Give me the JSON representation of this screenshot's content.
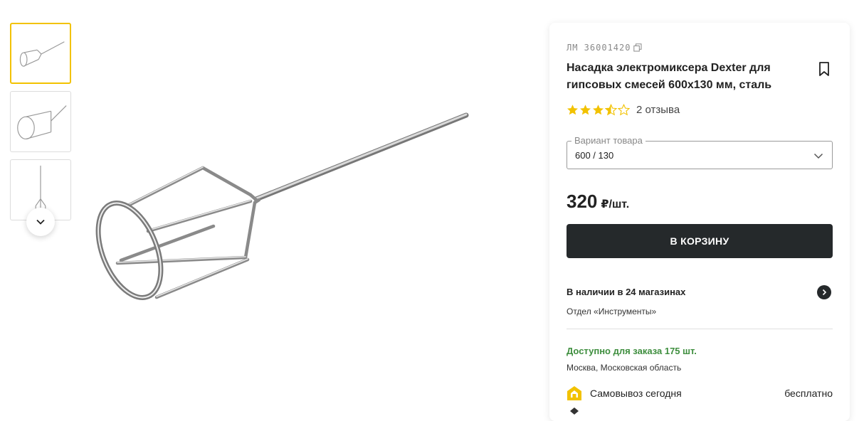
{
  "gallery": {
    "thumbnails": [
      {
        "name": "thumbnail-1",
        "active": true
      },
      {
        "name": "thumbnail-2",
        "active": false
      },
      {
        "name": "thumbnail-3",
        "active": false
      }
    ],
    "scroll_icon": "chevron-down-icon"
  },
  "product": {
    "sku": "ЛМ 36001420",
    "copy_icon": "copy-icon",
    "title": "Насадка электромиксера Dexter для гипсовых смесей 600x130 мм, сталь",
    "bookmark_icon": "bookmark-icon",
    "rating": 3.5,
    "reviews": "2 отзыва",
    "variant_label": "Вариант товара",
    "variant_value": "600 / 130",
    "price": "320",
    "price_unit": "₽/шт.",
    "cart_button": "В КОРЗИНУ",
    "stock_title": "В наличии в 24 магазинах",
    "stock_dept": "Отдел «Инструменты»",
    "order_title": "Доступно для заказа 175 шт.",
    "order_region": "Москва, Московская область",
    "pickup_label": "Самовывоз сегодня",
    "pickup_price": "бесплатно"
  },
  "colors": {
    "accent_yellow": "#f2c200",
    "button_dark": "#25292b",
    "available_green": "#3e8e3e",
    "star": "#f2c200"
  }
}
